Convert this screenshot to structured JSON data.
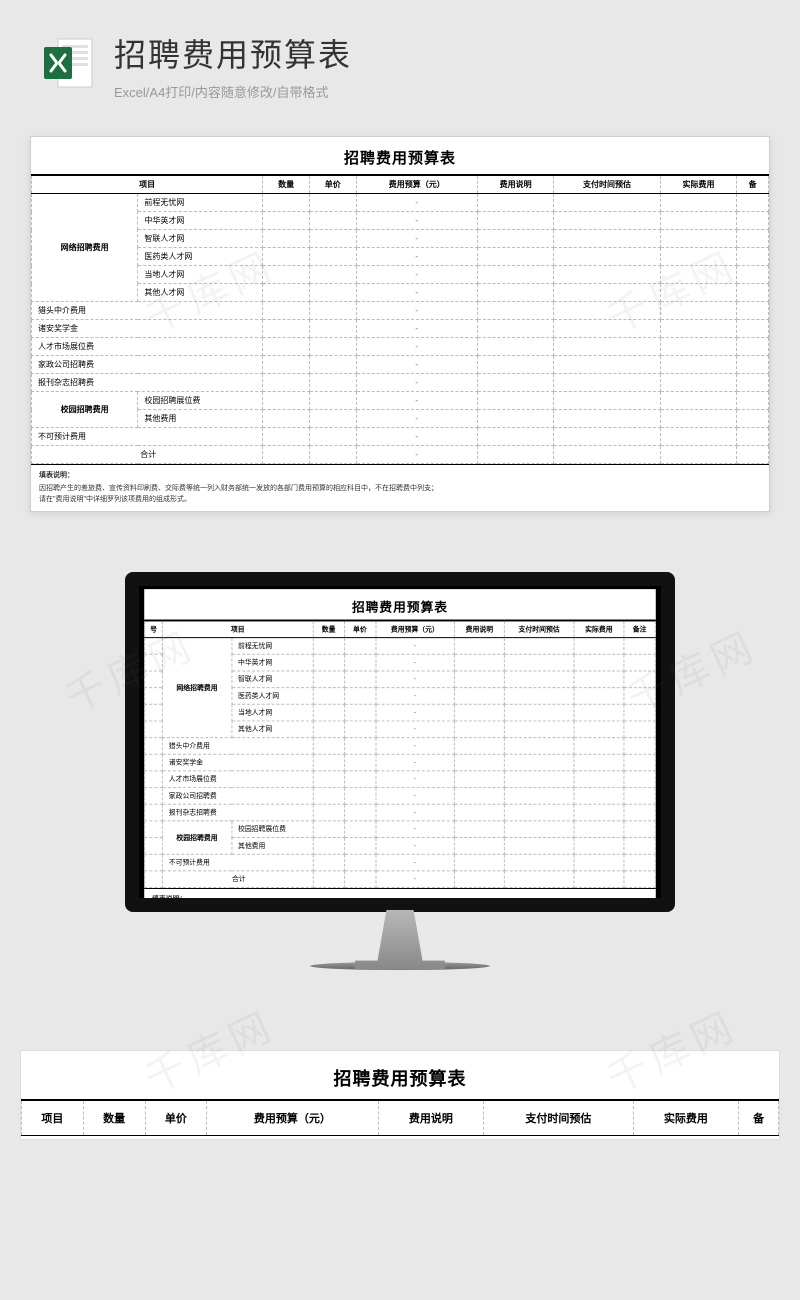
{
  "header": {
    "title": "招聘费用预算表",
    "subtitle": "Excel/A4打印/内容随意修改/自带格式",
    "icon": "excel-icon"
  },
  "sheet": {
    "title": "招聘费用预算表",
    "columns": [
      "项目",
      "数量",
      "单价",
      "费用预算（元）",
      "费用说明",
      "支付时间预估",
      "实际费用",
      "备"
    ],
    "columns_full": [
      "号",
      "项目",
      "数量",
      "单价",
      "费用预算（元）",
      "费用说明",
      "支付时间预估",
      "实际费用",
      "备注"
    ],
    "groups": [
      {
        "name": "网络招聘费用",
        "items": [
          "前程无忧网",
          "中华英才网",
          "智联人才网",
          "医药类人才网",
          "当地人才网",
          "其他人才网"
        ]
      },
      {
        "name": "猎头中介费用",
        "items": []
      },
      {
        "name": "诸安奖学金",
        "items": []
      },
      {
        "name": "人才市场展位费",
        "items": []
      },
      {
        "name": "家政公司招聘费",
        "items": []
      },
      {
        "name": "报刊杂志招聘费",
        "items": []
      },
      {
        "name": "校园招聘费用",
        "items": [
          "校园招聘展位费",
          "其他费用"
        ]
      },
      {
        "name": "不可预计费用",
        "items": []
      },
      {
        "name": "合计",
        "items": []
      }
    ],
    "dash": "-",
    "notes_title": "填表说明：",
    "note1": "因招聘产生的差旅费、宣传资料印刷费、交际费等统一列入财务部统一发放的各部门费用预算的相应科目中，不在招聘费中列支；",
    "note2": "请在\"费用说明\"中详细罗列该项费用的组成形式。",
    "note1_num": "1.因招聘产生的差旅费、宣传资料印刷费、交际费等统一列入财务部统一发放的各部门费用预算的相应科目中，不在招聘费中列支；",
    "note2_num": "2.请在\"费用说明\"中详细罗列该项费用的组成形式。"
  },
  "watermark": "千库网"
}
